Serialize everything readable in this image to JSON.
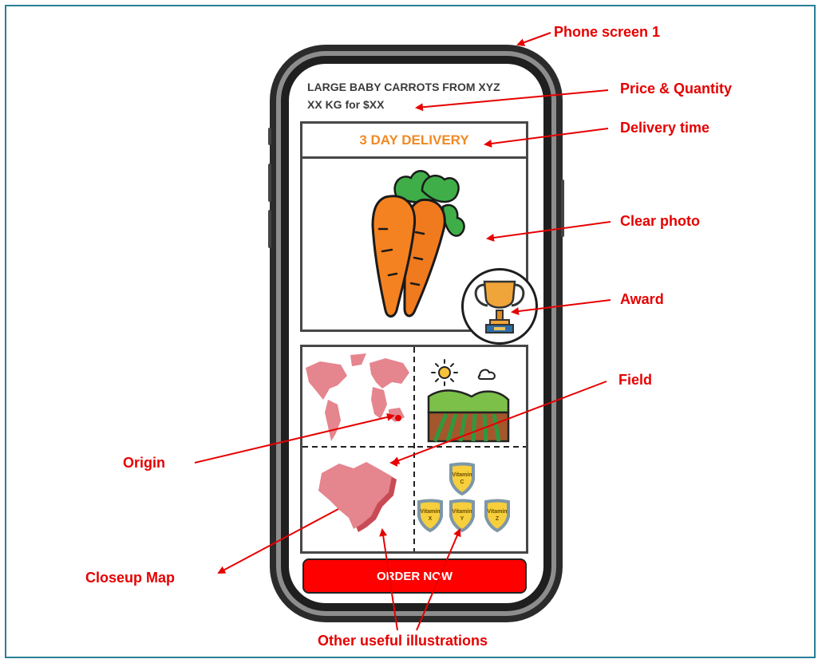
{
  "product": {
    "title": "LARGE BABY CARROTS FROM XYZ",
    "price_quantity": "XX KG for $XX",
    "delivery": "3 DAY DELIVERY",
    "order_button": "ORDER NOW"
  },
  "vitamins": {
    "c": [
      "Vitamin",
      "C"
    ],
    "x": [
      "Vitamin",
      "X"
    ],
    "y": [
      "Vitamin",
      "Y"
    ],
    "z": [
      "Vitamin",
      "Z"
    ]
  },
  "annotations": {
    "phone_screen": "Phone screen 1",
    "price_quantity": "Price & Quantity",
    "delivery_time": "Delivery time",
    "clear_photo": "Clear photo",
    "award": "Award",
    "field": "Field",
    "origin": "Origin",
    "closeup_map": "Closeup Map",
    "other_illustrations": "Other useful illustrations"
  },
  "colors": {
    "accent_red": "#e60000",
    "delivery_orange": "#f08a24",
    "button_red": "#ff0000",
    "frame_teal": "#2a7f97"
  }
}
